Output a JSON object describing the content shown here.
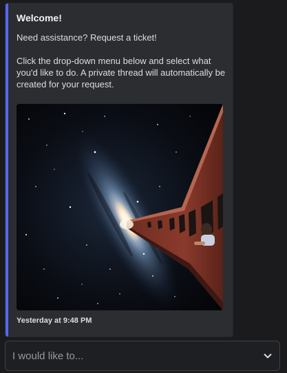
{
  "embed": {
    "accent_color": "#5865f2",
    "title": "Welcome!",
    "description_line1": "Need assistance? Request a ticket!",
    "description_line2": "Click the drop-down menu below and select what you'd like to do. A private thread will automatically be created for your request.",
    "image": "galaxy-train-illustration",
    "timestamp": "Yesterday at 9:48 PM"
  },
  "select": {
    "placeholder": "I would like to...",
    "icon": "chevron-down-icon"
  }
}
